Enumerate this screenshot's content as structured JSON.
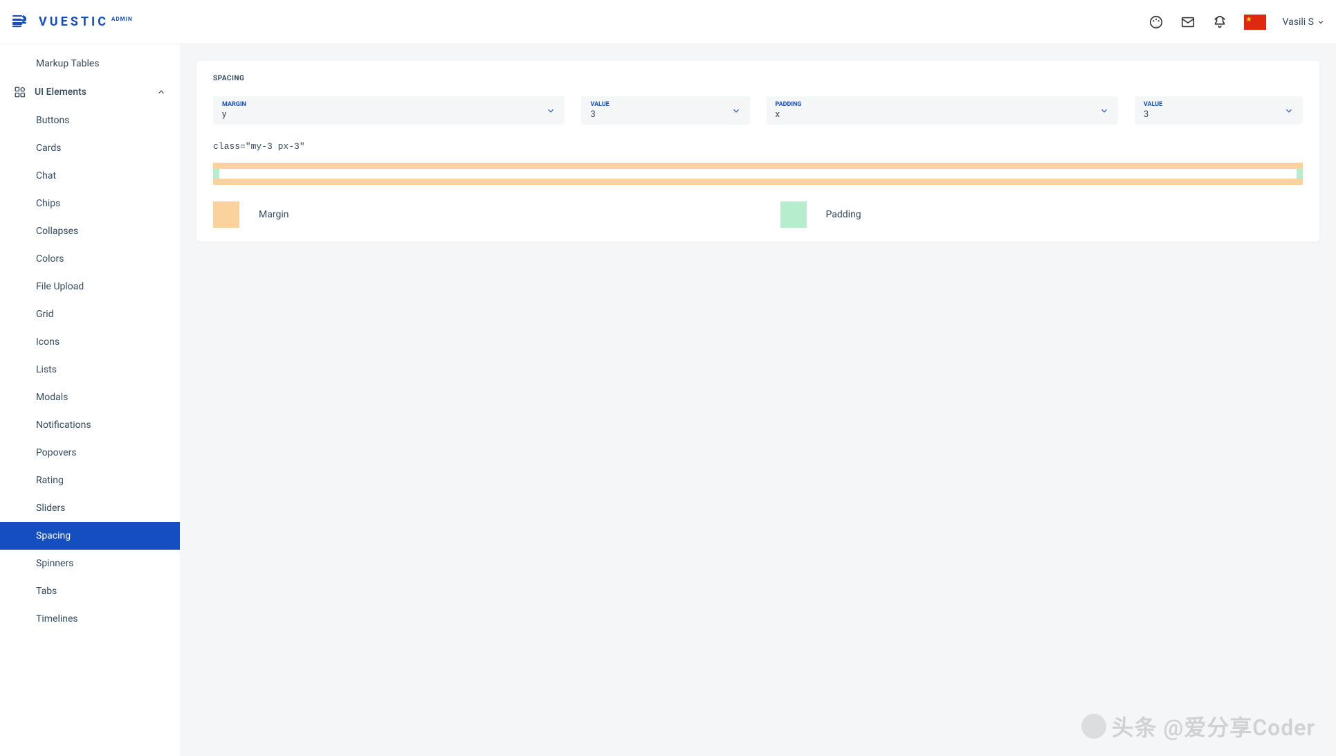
{
  "header": {
    "logo_main": "VUESTIC",
    "logo_sub": "ADMIN",
    "user_name": "Vasili S"
  },
  "sidebar": {
    "items_above": [
      "Markup Tables"
    ],
    "parent": "UI Elements",
    "children": [
      "Buttons",
      "Cards",
      "Chat",
      "Chips",
      "Collapses",
      "Colors",
      "File Upload",
      "Grid",
      "Icons",
      "Lists",
      "Modals",
      "Notifications",
      "Popovers",
      "Rating",
      "Sliders",
      "Spacing",
      "Spinners",
      "Tabs",
      "Timelines"
    ],
    "active": "Spacing"
  },
  "card": {
    "title": "SPACING",
    "selects": [
      {
        "label": "MARGIN",
        "value": "y",
        "narrow": false
      },
      {
        "label": "VALUE",
        "value": "3",
        "narrow": true
      },
      {
        "label": "PADDING",
        "value": "x",
        "narrow": false
      },
      {
        "label": "VALUE",
        "value": "3",
        "narrow": true
      }
    ],
    "code": "class=\"my-3 px-3\"",
    "legend": {
      "margin": "Margin",
      "padding": "Padding"
    }
  },
  "watermark": "头条 @爱分享Coder",
  "colors": {
    "margin": "#fbd29b",
    "padding": "#b6edcd",
    "primary": "#154ec1"
  }
}
